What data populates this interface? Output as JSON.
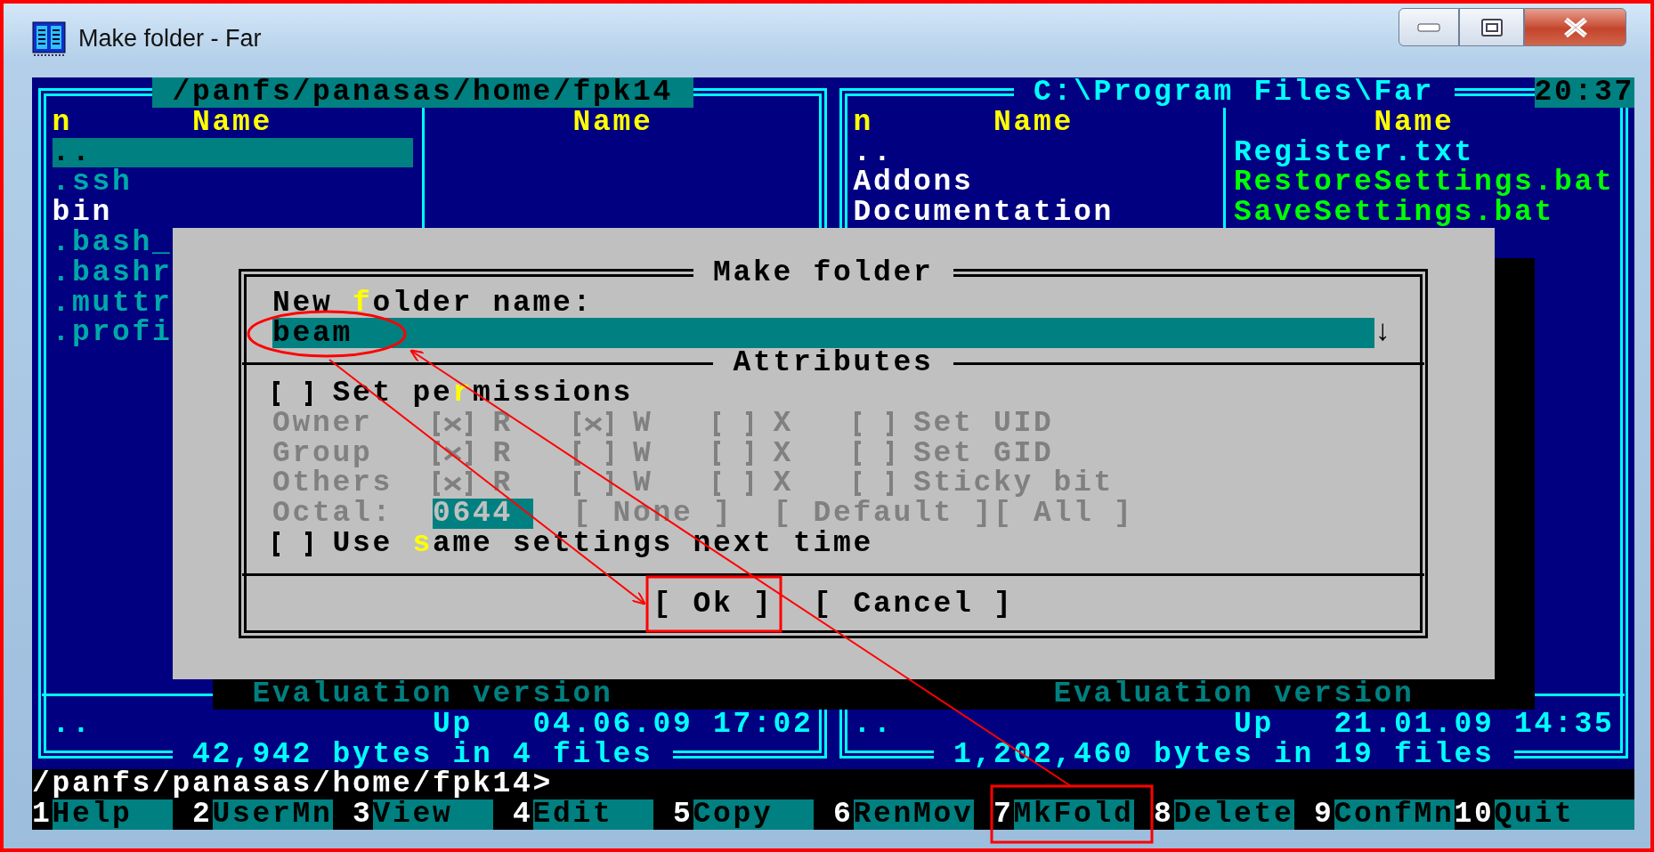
{
  "window": {
    "title": "Make folder - Far"
  },
  "panels": [
    {
      "path": "/panfs/panasas/home/fpk14",
      "active": true,
      "sort_mark": "n",
      "columns": [
        {
          "header": "Name",
          "files": [
            {
              "name": "..",
              "kind": "up",
              "selected": true
            },
            {
              "name": ".ssh",
              "kind": "hidden",
              "selected": false
            },
            {
              "name": "bin",
              "kind": "folder",
              "selected": false
            },
            {
              "name": ".bash_",
              "kind": "hidden",
              "selected": false
            },
            {
              "name": ".bashr",
              "kind": "hidden",
              "selected": false
            },
            {
              "name": ".muttr",
              "kind": "hidden",
              "selected": false
            },
            {
              "name": ".profi",
              "kind": "hidden",
              "selected": false
            }
          ]
        },
        {
          "header": "Name"
        }
      ],
      "info": "Evaluation version",
      "status": {
        "name": "..",
        "type": "Up",
        "date": "04.06.09",
        "time": "17:02"
      },
      "totals": "42,942 bytes in 4 files"
    },
    {
      "path": "C:\\Program Files\\Far",
      "active": false,
      "clock": "20:37",
      "sort_mark": "n",
      "columns": [
        {
          "header": "Name",
          "files": [
            {
              "name": "..",
              "kind": "up",
              "selected": false
            },
            {
              "name": "Addons",
              "kind": "folder",
              "selected": false
            },
            {
              "name": "Documentation",
              "kind": "folder",
              "selected": false
            }
          ]
        },
        {
          "header": "Name",
          "files": [
            {
              "name": "Register.txt",
              "kind": "file",
              "selected": false
            },
            {
              "name": "RestoreSettings.bat",
              "kind": "executable",
              "selected": false
            },
            {
              "name": "SaveSettings.bat",
              "kind": "executable",
              "selected": false
            }
          ]
        }
      ],
      "info": "Evaluation version",
      "status": {
        "name": "..",
        "type": "Up",
        "date": "21.01.09",
        "time": "14:35"
      },
      "totals": "1,202,460 bytes in 19 files"
    }
  ],
  "dialog": {
    "title": "Make folder",
    "name_label": "New **f**older name:",
    "name_value": "beam",
    "history_arrow": "↓",
    "section": "Attributes",
    "set_permissions": {
      "label": "Set pe**r**missions",
      "checked": false
    },
    "permissions": [
      {
        "label": "Owner",
        "disabled": true,
        "boxes": [
          {
            "label": "R",
            "checked": true
          },
          {
            "label": "W",
            "checked": true
          },
          {
            "label": "X",
            "checked": false
          },
          {
            "label": "Set UID",
            "checked": false
          }
        ]
      },
      {
        "label": "Group",
        "disabled": true,
        "boxes": [
          {
            "label": "R",
            "checked": true
          },
          {
            "label": "W",
            "checked": false
          },
          {
            "label": "X",
            "checked": false
          },
          {
            "label": "Set GID",
            "checked": false
          }
        ]
      },
      {
        "label": "Others",
        "disabled": true,
        "boxes": [
          {
            "label": "R",
            "checked": true
          },
          {
            "label": "W",
            "checked": false
          },
          {
            "label": "X",
            "checked": false
          },
          {
            "label": "Sticky bit",
            "checked": false
          }
        ]
      }
    ],
    "octal": {
      "label": "Octal:",
      "value": "0644",
      "disabled": true,
      "buttons": [
        "[ None ]",
        "[ Default ]",
        "[ All ]"
      ]
    },
    "same_settings": {
      "label": "Use **s**ame settings next time",
      "checked": false
    },
    "buttons": [
      "[ Ok ]",
      "[ Cancel ]"
    ]
  },
  "command_line": "/panfs/panasas/home/fpk14>",
  "keybar": [
    {
      "key": "1",
      "label": "Help"
    },
    {
      "key": "2",
      "label": "UserMn"
    },
    {
      "key": "3",
      "label": "View"
    },
    {
      "key": "4",
      "label": "Edit"
    },
    {
      "key": "5",
      "label": "Copy"
    },
    {
      "key": "6",
      "label": "RenMov"
    },
    {
      "key": "7",
      "label": "MkFold"
    },
    {
      "key": "8",
      "label": "Delete"
    },
    {
      "key": "9",
      "label": "ConfMn"
    },
    {
      "key": "10",
      "label": "Quit"
    }
  ]
}
